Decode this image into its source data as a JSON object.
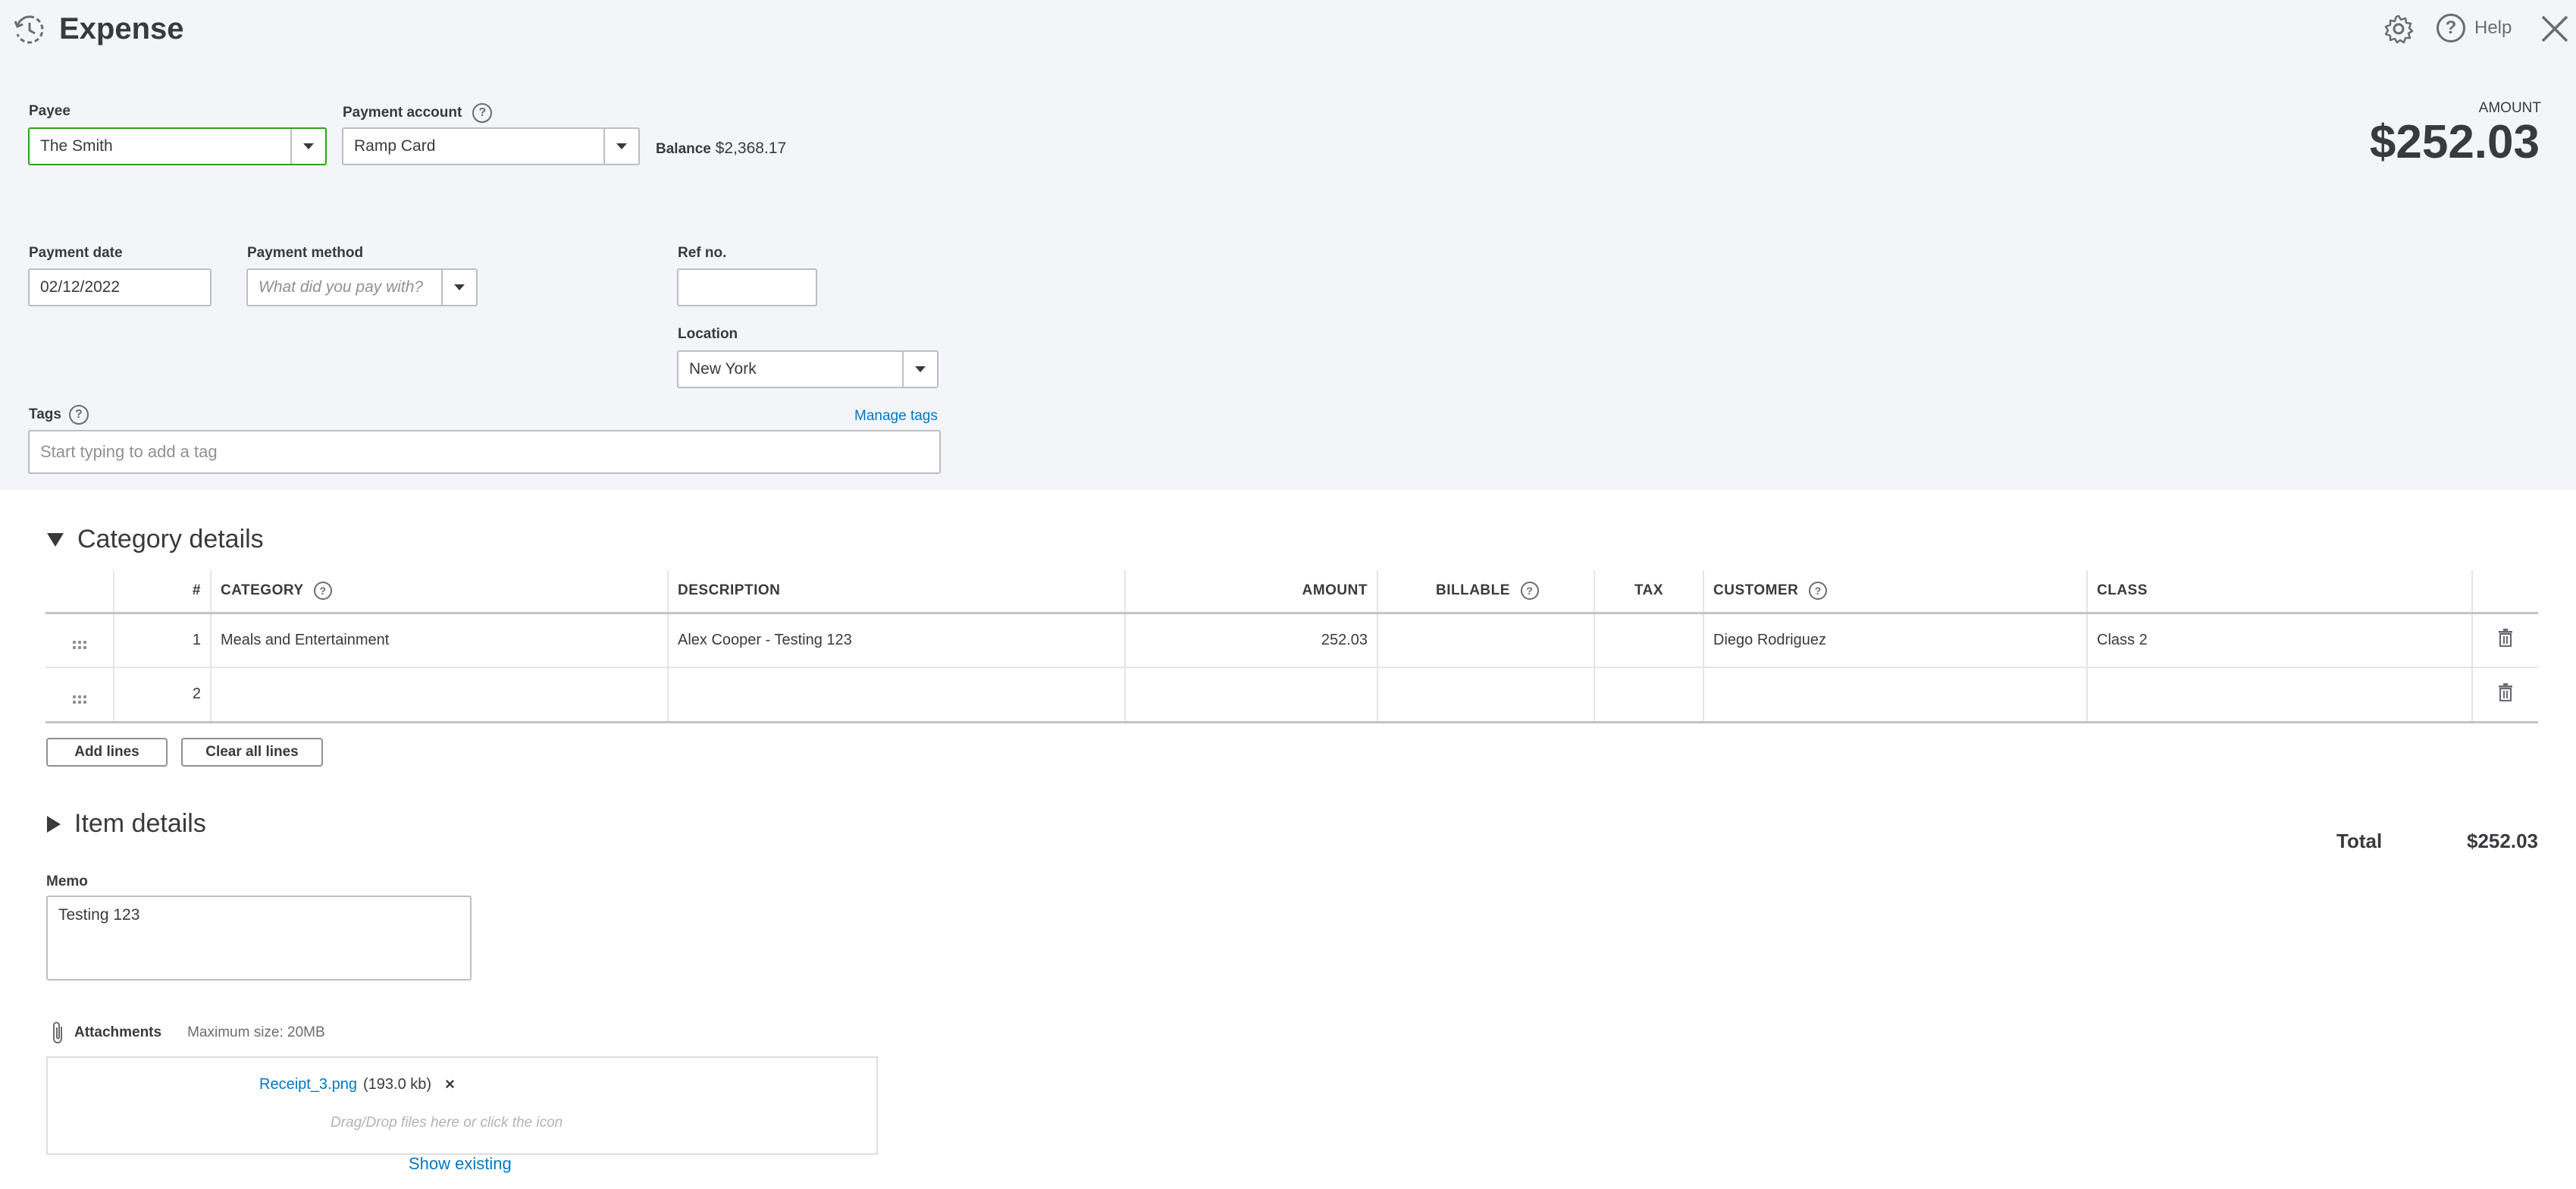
{
  "header": {
    "title": "Expense",
    "help_label": "Help"
  },
  "payee": {
    "label": "Payee",
    "value": "The Smith"
  },
  "payment_account": {
    "label": "Payment account",
    "value": "Ramp Card"
  },
  "balance": {
    "label": "Balance",
    "value": "$2,368.17"
  },
  "amount": {
    "label": "AMOUNT",
    "value": "$252.03"
  },
  "payment_date": {
    "label": "Payment date",
    "value": "02/12/2022"
  },
  "payment_method": {
    "label": "Payment method",
    "placeholder": "What did you pay with?"
  },
  "ref_no": {
    "label": "Ref no.",
    "value": ""
  },
  "location": {
    "label": "Location",
    "value": "New York"
  },
  "tags": {
    "label": "Tags",
    "manage_label": "Manage tags",
    "placeholder": "Start typing to add a tag"
  },
  "category_details": {
    "title": "Category details",
    "columns": {
      "num": "#",
      "category": "CATEGORY",
      "description": "DESCRIPTION",
      "amount": "AMOUNT",
      "billable": "BILLABLE",
      "tax": "TAX",
      "customer": "CUSTOMER",
      "class": "CLASS"
    },
    "rows": [
      {
        "num": "1",
        "category": "Meals and Entertainment",
        "description": "Alex Cooper - Testing 123",
        "amount": "252.03",
        "billable": "",
        "tax": "",
        "customer": "Diego Rodriguez",
        "class": "Class 2"
      },
      {
        "num": "2",
        "category": "",
        "description": "",
        "amount": "",
        "billable": "",
        "tax": "",
        "customer": "",
        "class": ""
      }
    ],
    "add_lines_label": "Add lines",
    "clear_lines_label": "Clear all lines"
  },
  "item_details": {
    "title": "Item details"
  },
  "total": {
    "label": "Total",
    "value": "$252.03"
  },
  "memo": {
    "label": "Memo",
    "value": "Testing 123"
  },
  "attachments": {
    "label": "Attachments",
    "max_size": "Maximum size: 20MB",
    "file_name": "Receipt_3.png",
    "file_size": "(193.0 kb)",
    "drop_hint": "Drag/Drop files here or click the icon",
    "show_existing": "Show existing"
  }
}
